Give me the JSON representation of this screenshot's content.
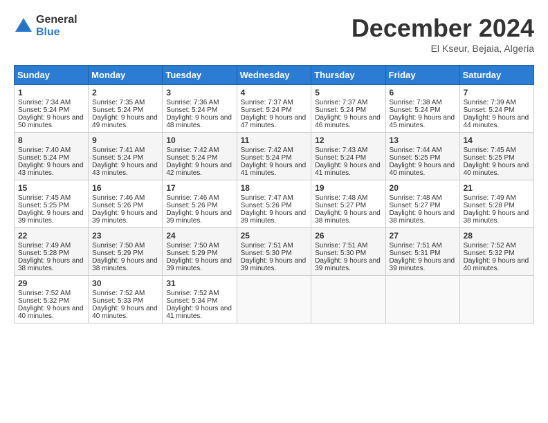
{
  "logo": {
    "general": "General",
    "blue": "Blue"
  },
  "header": {
    "month": "December 2024",
    "location": "El Kseur, Bejaia, Algeria"
  },
  "weekdays": [
    "Sunday",
    "Monday",
    "Tuesday",
    "Wednesday",
    "Thursday",
    "Friday",
    "Saturday"
  ],
  "weeks": [
    [
      {
        "day": "1",
        "sunrise": "Sunrise: 7:34 AM",
        "sunset": "Sunset: 5:24 PM",
        "daylight": "Daylight: 9 hours and 50 minutes."
      },
      {
        "day": "2",
        "sunrise": "Sunrise: 7:35 AM",
        "sunset": "Sunset: 5:24 PM",
        "daylight": "Daylight: 9 hours and 49 minutes."
      },
      {
        "day": "3",
        "sunrise": "Sunrise: 7:36 AM",
        "sunset": "Sunset: 5:24 PM",
        "daylight": "Daylight: 9 hours and 48 minutes."
      },
      {
        "day": "4",
        "sunrise": "Sunrise: 7:37 AM",
        "sunset": "Sunset: 5:24 PM",
        "daylight": "Daylight: 9 hours and 47 minutes."
      },
      {
        "day": "5",
        "sunrise": "Sunrise: 7:37 AM",
        "sunset": "Sunset: 5:24 PM",
        "daylight": "Daylight: 9 hours and 46 minutes."
      },
      {
        "day": "6",
        "sunrise": "Sunrise: 7:38 AM",
        "sunset": "Sunset: 5:24 PM",
        "daylight": "Daylight: 9 hours and 45 minutes."
      },
      {
        "day": "7",
        "sunrise": "Sunrise: 7:39 AM",
        "sunset": "Sunset: 5:24 PM",
        "daylight": "Daylight: 9 hours and 44 minutes."
      }
    ],
    [
      {
        "day": "8",
        "sunrise": "Sunrise: 7:40 AM",
        "sunset": "Sunset: 5:24 PM",
        "daylight": "Daylight: 9 hours and 43 minutes."
      },
      {
        "day": "9",
        "sunrise": "Sunrise: 7:41 AM",
        "sunset": "Sunset: 5:24 PM",
        "daylight": "Daylight: 9 hours and 43 minutes."
      },
      {
        "day": "10",
        "sunrise": "Sunrise: 7:42 AM",
        "sunset": "Sunset: 5:24 PM",
        "daylight": "Daylight: 9 hours and 42 minutes."
      },
      {
        "day": "11",
        "sunrise": "Sunrise: 7:42 AM",
        "sunset": "Sunset: 5:24 PM",
        "daylight": "Daylight: 9 hours and 41 minutes."
      },
      {
        "day": "12",
        "sunrise": "Sunrise: 7:43 AM",
        "sunset": "Sunset: 5:24 PM",
        "daylight": "Daylight: 9 hours and 41 minutes."
      },
      {
        "day": "13",
        "sunrise": "Sunrise: 7:44 AM",
        "sunset": "Sunset: 5:25 PM",
        "daylight": "Daylight: 9 hours and 40 minutes."
      },
      {
        "day": "14",
        "sunrise": "Sunrise: 7:45 AM",
        "sunset": "Sunset: 5:25 PM",
        "daylight": "Daylight: 9 hours and 40 minutes."
      }
    ],
    [
      {
        "day": "15",
        "sunrise": "Sunrise: 7:45 AM",
        "sunset": "Sunset: 5:25 PM",
        "daylight": "Daylight: 9 hours and 39 minutes."
      },
      {
        "day": "16",
        "sunrise": "Sunrise: 7:46 AM",
        "sunset": "Sunset: 5:26 PM",
        "daylight": "Daylight: 9 hours and 39 minutes."
      },
      {
        "day": "17",
        "sunrise": "Sunrise: 7:46 AM",
        "sunset": "Sunset: 5:26 PM",
        "daylight": "Daylight: 9 hours and 39 minutes."
      },
      {
        "day": "18",
        "sunrise": "Sunrise: 7:47 AM",
        "sunset": "Sunset: 5:26 PM",
        "daylight": "Daylight: 9 hours and 39 minutes."
      },
      {
        "day": "19",
        "sunrise": "Sunrise: 7:48 AM",
        "sunset": "Sunset: 5:27 PM",
        "daylight": "Daylight: 9 hours and 38 minutes."
      },
      {
        "day": "20",
        "sunrise": "Sunrise: 7:48 AM",
        "sunset": "Sunset: 5:27 PM",
        "daylight": "Daylight: 9 hours and 38 minutes."
      },
      {
        "day": "21",
        "sunrise": "Sunrise: 7:49 AM",
        "sunset": "Sunset: 5:28 PM",
        "daylight": "Daylight: 9 hours and 38 minutes."
      }
    ],
    [
      {
        "day": "22",
        "sunrise": "Sunrise: 7:49 AM",
        "sunset": "Sunset: 5:28 PM",
        "daylight": "Daylight: 9 hours and 38 minutes."
      },
      {
        "day": "23",
        "sunrise": "Sunrise: 7:50 AM",
        "sunset": "Sunset: 5:29 PM",
        "daylight": "Daylight: 9 hours and 38 minutes."
      },
      {
        "day": "24",
        "sunrise": "Sunrise: 7:50 AM",
        "sunset": "Sunset: 5:29 PM",
        "daylight": "Daylight: 9 hours and 39 minutes."
      },
      {
        "day": "25",
        "sunrise": "Sunrise: 7:51 AM",
        "sunset": "Sunset: 5:30 PM",
        "daylight": "Daylight: 9 hours and 39 minutes."
      },
      {
        "day": "26",
        "sunrise": "Sunrise: 7:51 AM",
        "sunset": "Sunset: 5:30 PM",
        "daylight": "Daylight: 9 hours and 39 minutes."
      },
      {
        "day": "27",
        "sunrise": "Sunrise: 7:51 AM",
        "sunset": "Sunset: 5:31 PM",
        "daylight": "Daylight: 9 hours and 39 minutes."
      },
      {
        "day": "28",
        "sunrise": "Sunrise: 7:52 AM",
        "sunset": "Sunset: 5:32 PM",
        "daylight": "Daylight: 9 hours and 40 minutes."
      }
    ],
    [
      {
        "day": "29",
        "sunrise": "Sunrise: 7:52 AM",
        "sunset": "Sunset: 5:32 PM",
        "daylight": "Daylight: 9 hours and 40 minutes."
      },
      {
        "day": "30",
        "sunrise": "Sunrise: 7:52 AM",
        "sunset": "Sunset: 5:33 PM",
        "daylight": "Daylight: 9 hours and 40 minutes."
      },
      {
        "day": "31",
        "sunrise": "Sunrise: 7:52 AM",
        "sunset": "Sunset: 5:34 PM",
        "daylight": "Daylight: 9 hours and 41 minutes."
      },
      null,
      null,
      null,
      null
    ]
  ]
}
